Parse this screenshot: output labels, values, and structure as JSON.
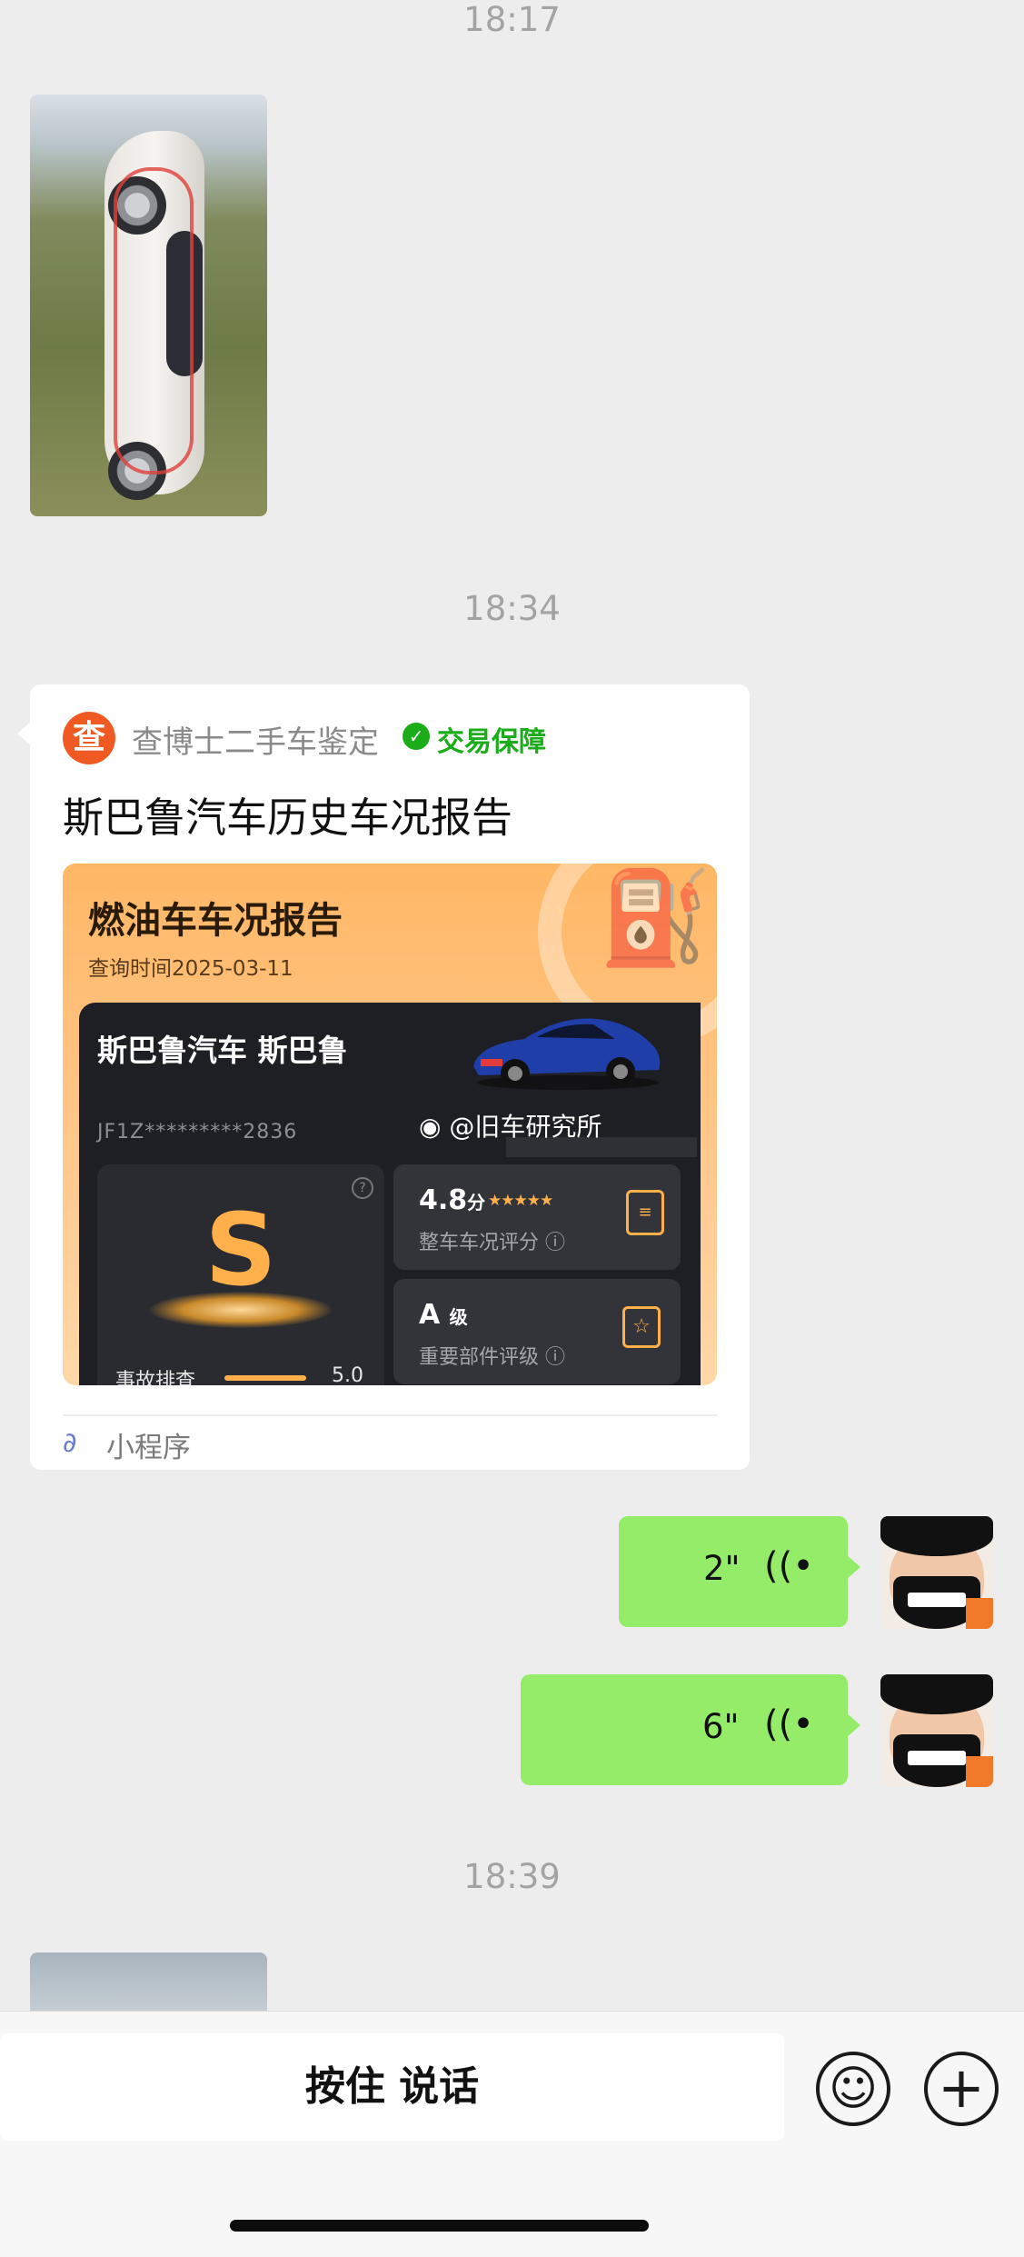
{
  "messages": {
    "time_1": "18:17",
    "time_2": "18:34",
    "time_3": "18:39"
  },
  "mini_program_card": {
    "brand_logo_char": "查",
    "brand_name": "查博士二手车鉴定",
    "guarantee": "交易保障",
    "title": "斯巴鲁汽车历史车况报告",
    "footer_label": "小程序",
    "report": {
      "heading": "燃油车车况报告",
      "query_date": "查询时间2025-03-11",
      "model": "斯巴鲁汽车 斯巴鲁",
      "vin": "JF1Z*********2836",
      "watermark": "@旧车研究所",
      "grade": "S",
      "accident_label": "事故排查",
      "accident_value": "5.0",
      "score_value": "4.8",
      "score_unit": "分",
      "score_stars": 5,
      "score_label": "整车车况评分",
      "level_value": "A",
      "level_unit": "级",
      "level_label": "重要部件评级"
    }
  },
  "voice_messages": [
    {
      "duration": "2\""
    },
    {
      "duration": "6\""
    }
  ],
  "input_bar": {
    "hold_to_talk": "按住 说话"
  },
  "icons": {
    "emoji": "emoji-icon",
    "plus": "plus-icon",
    "voice_wave": "voice-wave-icon",
    "mini_program": "mini-program-icon"
  },
  "colors": {
    "background": "#ededed",
    "voice_bubble": "#95ec69",
    "guarantee_green": "#1aad19",
    "brand_orange": "#ef5a22",
    "grade_gold": "#ffb04a"
  }
}
